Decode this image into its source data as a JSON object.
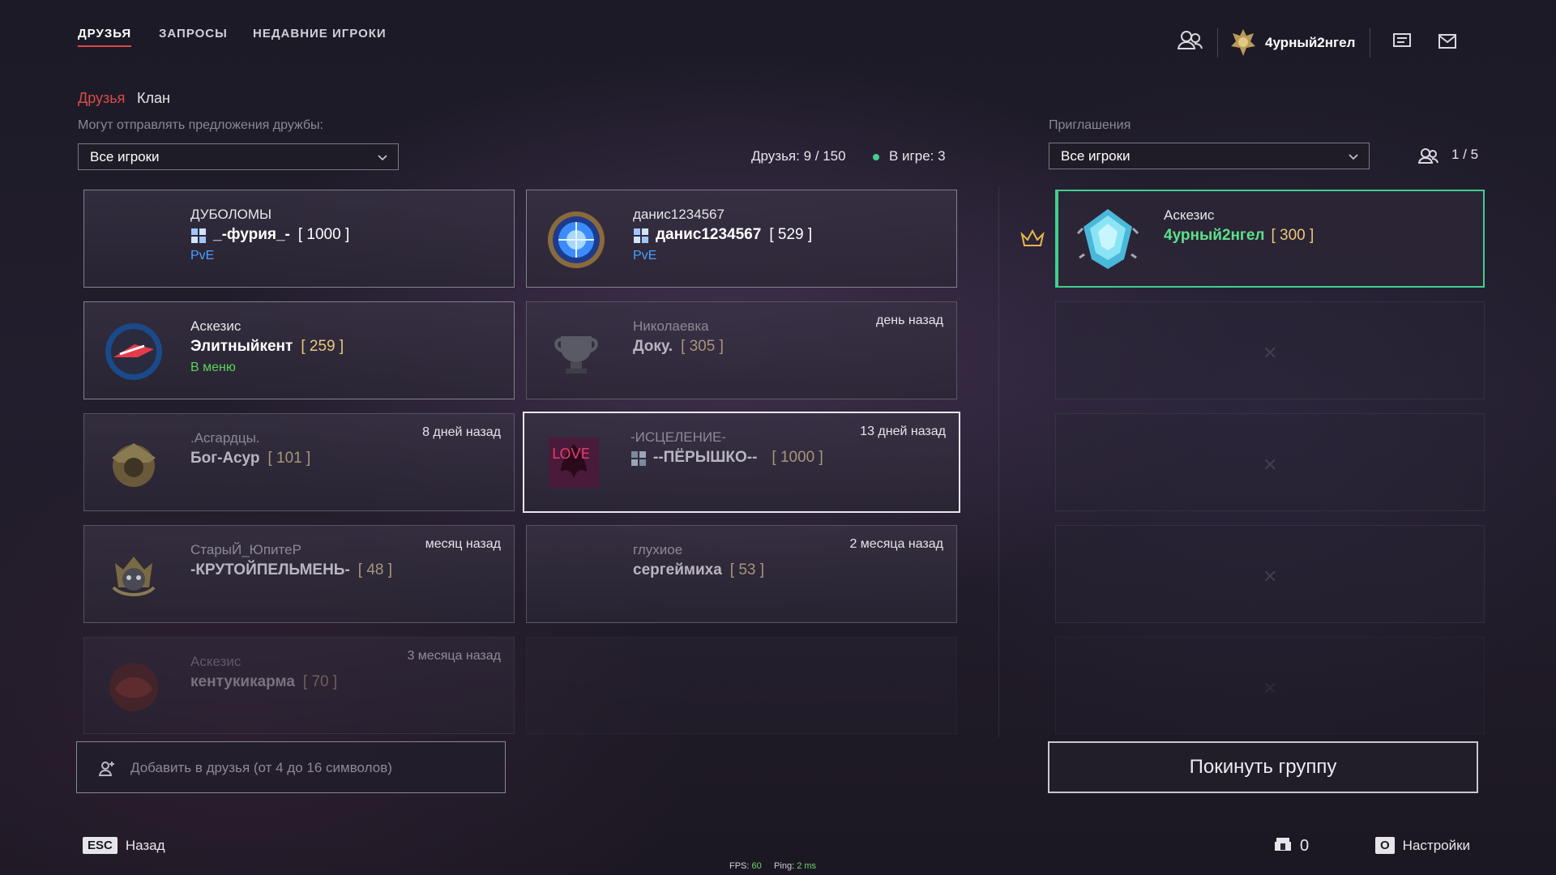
{
  "tabs": [
    {
      "label": "ДРУЗЬЯ",
      "active": true
    },
    {
      "label": "ЗАПРОСЫ",
      "active": false
    },
    {
      "label": "НЕДАВНИЕ ИГРОКИ",
      "active": false
    }
  ],
  "header": {
    "username": "4урный2нгел"
  },
  "subtabs": {
    "friends": "Друзья",
    "clan": "Клан"
  },
  "filters": {
    "friend_offers_label": "Могут отправлять предложения дружбы:",
    "friend_offers_value": "Все игроки",
    "invites_label": "Приглашения",
    "invites_value": "Все игроки"
  },
  "stats": {
    "friends": "Друзья: 9 / 150",
    "in_game": "В игре: 3"
  },
  "group": {
    "count": "1 / 5",
    "leader": {
      "clan": "Аскезис",
      "name": "4урный2нгел",
      "rank": "[ 300 ]"
    },
    "leave_label": "Покинуть группу"
  },
  "friends": [
    {
      "clan": "ДУБОЛОМЫ",
      "name": "_-фурия_-",
      "rank": "[ 1000 ]",
      "status": "PvE",
      "when": ""
    },
    {
      "clan": "данис1234567",
      "name": "данис1234567",
      "rank": "[ 529 ]",
      "status": "PvE",
      "when": ""
    },
    {
      "clan": "Аскезис",
      "name": "Элитныйкент",
      "rank": "[ 259 ]",
      "status": "В меню",
      "when": ""
    },
    {
      "clan": "Николаевка",
      "name": "Доку.",
      "rank": "[ 305 ]",
      "status": "",
      "when": "день назад"
    },
    {
      "clan": ".Асгардцы.",
      "name": "Бог-Асур",
      "rank": "[ 101 ]",
      "status": "",
      "when": "8 дней назад"
    },
    {
      "clan": "-ИСЦЕЛЕНИЕ-",
      "name": "--ПЁРЫШКО--",
      "rank": "[ 1000 ]",
      "status": "",
      "when": "13 дней назад"
    },
    {
      "clan": "СтарыЙ_ЮпитеР",
      "name": "-КРУТОЙПЕЛЬМЕНЬ-",
      "rank": "[ 48 ]",
      "status": "",
      "when": "месяц назад"
    },
    {
      "clan": "глухиое",
      "name": "сергеймиха",
      "rank": "[ 53 ]",
      "status": "",
      "when": "2 месяца назад"
    },
    {
      "clan": "Аскезис",
      "name": "кентукикарма",
      "rank": "[ 70 ]",
      "status": "",
      "when": "3 месяца назад"
    }
  ],
  "add_friend": {
    "placeholder": "Добавить в друзья (от 4 до 16 символов)"
  },
  "footer": {
    "esc_key": "ESC",
    "back_label": "Назад",
    "currency_value": "0",
    "settings_key": "O",
    "settings_label": "Настройки",
    "fps_label": "FPS:",
    "fps_value": "60",
    "ping_label": "Ping:",
    "ping_value": "2",
    "ping_unit": "ms"
  },
  "colors": {
    "accent_red": "#d94a4a",
    "online_green": "#5bd35b",
    "pve_blue": "#4aa0ff",
    "rank_gold": "#e8c87a",
    "leader_green": "#3fcf8e"
  }
}
